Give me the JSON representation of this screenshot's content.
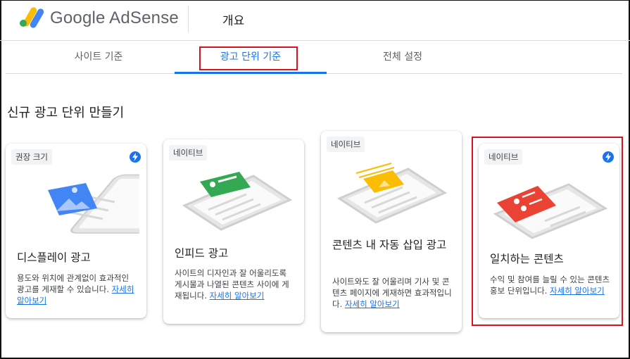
{
  "header": {
    "logo_text": "Google AdSense",
    "page_title": "개요"
  },
  "tabs": [
    {
      "label": "사이트 기준",
      "active": false
    },
    {
      "label": "광고 단위 기준",
      "active": true
    },
    {
      "label": "전체 설정",
      "active": false
    }
  ],
  "section_title": "신규 광고 단위 만들기",
  "cards": [
    {
      "chip": "권장 크기",
      "title": "디스플레이 광고",
      "desc": "용도와 위치에 관계없이 효과적인 광고를 게재할 수 있습니다.",
      "link": "자세히 알아보기",
      "accent": "#4285f4",
      "bolt": true
    },
    {
      "chip": "네이티브",
      "title": "인피드 광고",
      "desc": "사이트의 디자인과 잘 어울리도록 게시물과 나열된 콘텐츠 사이에 게재됩니다.",
      "link": "자세히 알아보기",
      "accent": "#34a853",
      "bolt": false
    },
    {
      "chip": "네이티브",
      "title": "콘텐츠 내 자동 삽입 광고",
      "desc": "사이트와도 잘 어울리며 기사 및 콘텐츠 페이지에 게재하면 효과적입니다.",
      "link": "자세히 알아보기",
      "accent": "#fbbc04",
      "bolt": false
    },
    {
      "chip": "네이티브",
      "title": "일치하는 콘텐츠",
      "desc": "수익 및 참여를 늘릴 수 있는 콘텐츠 홍보 단위입니다.",
      "link": "자세히 알아보기",
      "accent": "#ea4335",
      "bolt": true
    }
  ],
  "colors": {
    "primary": "#1a73e8",
    "highlight": "#d7131e"
  }
}
